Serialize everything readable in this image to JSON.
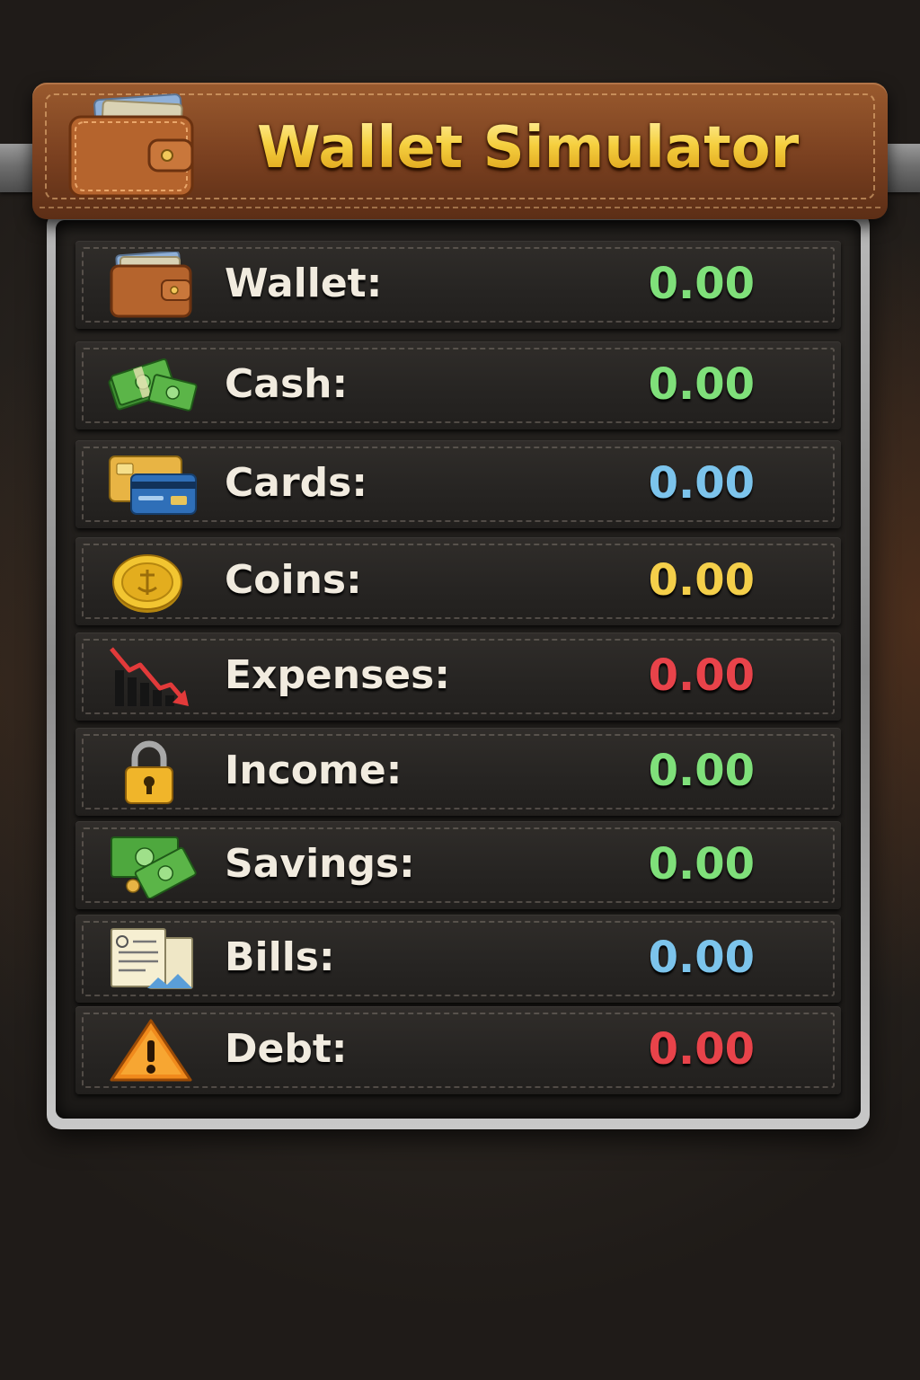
{
  "app": {
    "title": "Wallet Simulator"
  },
  "colors": {
    "green": "#7fe07a",
    "blue": "#7cc4ec",
    "gold": "#f4cf4a",
    "red": "#e8434a",
    "label": "#f1ebdf"
  },
  "rows": [
    {
      "label": "Wallet:",
      "value": "0.00",
      "icon": "wallet-icon",
      "color": "#7fe07a"
    },
    {
      "label": "Cash:",
      "value": "0.00",
      "icon": "cash-stack-icon",
      "color": "#7fe07a"
    },
    {
      "label": "Cards:",
      "value": "0.00",
      "icon": "credit-cards-icon",
      "color": "#7cc4ec"
    },
    {
      "label": "Coins:",
      "value": "0.00",
      "icon": "gold-coin-icon",
      "color": "#f4cf4a"
    },
    {
      "label": "Expenses:",
      "value": "0.00",
      "icon": "down-trend-chart-icon",
      "color": "#e8434a"
    },
    {
      "label": "Income:",
      "value": "0.00",
      "icon": "padlock-icon",
      "color": "#7fe07a"
    },
    {
      "label": "Savings:",
      "value": "0.00",
      "icon": "money-bills-icon",
      "color": "#7fe07a"
    },
    {
      "label": "Bills:",
      "value": "0.00",
      "icon": "bill-documents-icon",
      "color": "#7cc4ec"
    },
    {
      "label": "Debt:",
      "value": "0.00",
      "icon": "warning-icon",
      "color": "#e8434a"
    }
  ]
}
